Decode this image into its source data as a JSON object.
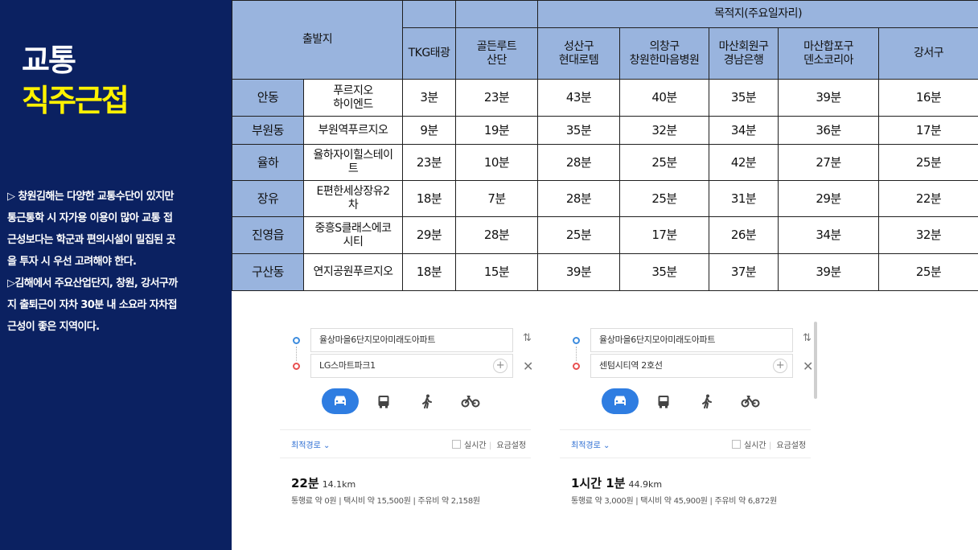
{
  "sidebar": {
    "title_line1": "교통",
    "title_line2": "직주근접",
    "desc": [
      "▷ 창원김해는 다양한 교통수단이 있지만",
      "통근통학 시 자가용 이용이 많아 교통 접",
      "근성보다는 학군과 편의시설이 밀집된 곳",
      "을 투자 시 우선 고려해야 한다.",
      "▷김해에서 주요산업단지, 창원, 강서구까",
      "지 출퇴근이 자차 30분 내 소요라 자차접",
      "근성이 좋은 지역이다."
    ]
  },
  "table": {
    "origin_header": "출발지",
    "destination_header": "목적지(주요일자리)",
    "destinations": [
      "TKG태광",
      "골든루트\n산단",
      "성산구\n현대로템",
      "의창구\n창원한마음병원",
      "마산회원구\n경남은행",
      "마산합포구\n덴소코리아",
      "강서구"
    ],
    "rows": [
      {
        "area": "안동",
        "complex": "푸르지오\n하이엔드",
        "times": [
          "3분",
          "23분",
          "43분",
          "40분",
          "35분",
          "39분",
          "16분"
        ]
      },
      {
        "area": "부원동",
        "complex": "부원역푸르지오",
        "times": [
          "9분",
          "19분",
          "35분",
          "32분",
          "34분",
          "36분",
          "17분"
        ]
      },
      {
        "area": "율하",
        "complex": "율하자이힐스테이\n트",
        "times": [
          "23분",
          "10분",
          "28분",
          "25분",
          "42분",
          "27분",
          "25분"
        ]
      },
      {
        "area": "장유",
        "complex": "E편한세상장유2\n차",
        "times": [
          "18분",
          "7분",
          "28분",
          "25분",
          "31분",
          "29분",
          "22분"
        ]
      },
      {
        "area": "진영읍",
        "complex": "중흥S클래스에코\n시티",
        "times": [
          "29분",
          "28분",
          "25분",
          "17분",
          "26분",
          "34분",
          "32분"
        ]
      },
      {
        "area": "구산동",
        "complex": "연지공원푸르지오",
        "times": [
          "18분",
          "15분",
          "39분",
          "35분",
          "37분",
          "39분",
          "25분"
        ]
      }
    ]
  },
  "routes": [
    {
      "origin": "율상마을6단지모아미래도아파트",
      "destination": "LG스마트파크1",
      "route_type": "최적경로 ⌄",
      "realtime_label": "실시간",
      "fare_label": "요금설정",
      "duration": "22분",
      "distance": "14.1km",
      "fees": "통행료 약 0원 | 택시비 약 15,500원 | 주유비 약 2,158원"
    },
    {
      "origin": "율상마을6단지모아미래도아파트",
      "destination": "센텀시티역 2호선",
      "route_type": "최적경로 ⌄",
      "realtime_label": "실시간",
      "fare_label": "요금설정",
      "duration": "1시간 1분",
      "distance": "44.9km",
      "fees": "통행료 약 3,000원 | 택시비 약 45,900원 | 주유비 약 6,872원"
    }
  ],
  "colors": {
    "panel_bg": "#0b2161",
    "title_highlight": "#fff200",
    "table_header_bg": "#99b4de",
    "active_mode": "#2f7de1"
  },
  "icons": {
    "mode_icons": [
      "car-icon",
      "bus-icon",
      "walk-icon",
      "bicycle-icon"
    ],
    "swap": "swap-icon",
    "close": "close-icon",
    "add": "plus-icon"
  }
}
